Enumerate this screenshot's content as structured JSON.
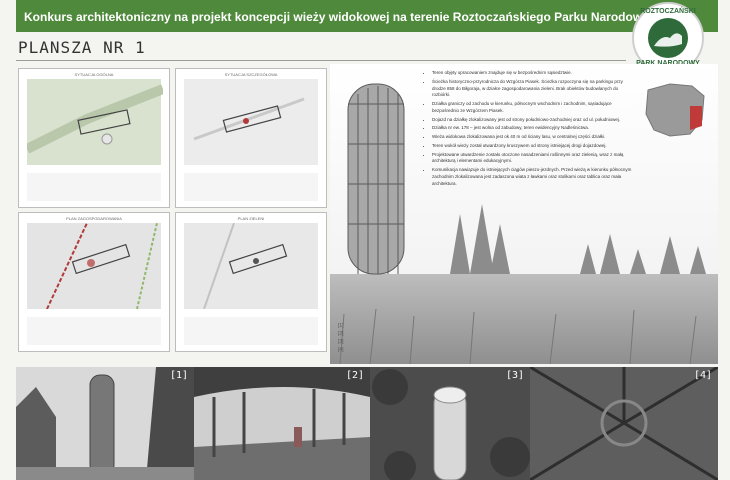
{
  "header": {
    "title": "Konkurs architektoniczny na projekt koncepcji wieży widokowej na terenie Roztoczańskiego Parku Narodowego"
  },
  "logo": {
    "top_text": "ROZTOCZAŃSKI",
    "bottom_text": "PARK NARODOWY"
  },
  "subtitle": "PLANSZA NR 1",
  "description_items": [
    "Teren objęty opracowaniem znajduje się w bezpośrednim sąsiedztwie.",
    "Ścieżka historyczno-przyrodnicza do Wzgórza Piasek. Ścieżka rozpoczyna się na parkingu przy drodze 858 do Biłgoraja, w działce zagospodarowania zieleni. Brak obiektów budowlanych do rozbiórki.",
    "Działka graniczy od zachodu w kierunku, północnym wschodnim i zachodnim, sąsiadujące bezpośrednio ze Wzgórzem Piasek.",
    "Dojazd na działkę zlokalizowany jest od strony południowo-zachodniej oraz od ul. południowej.",
    "Działka nr ew. 178 – jest wolna od zabudowy, teren ewidencyjny Nadleśnictwa.",
    "Wieża widokowa zlokalizowana jest ok 40 m od ściany lasu, w centralnej części działki.",
    "Teren wokół wieży został utwardzony kruszywem od strony istniejącej drogi dojazdowej.",
    "Projektowane utwardzenie zostało otoczone nasadzeniami roślinnymi oraz zielenią, wraz z małą architekturą i elementami edukacyjnymi.",
    "Komunikacja nawiązuje do istniejących ciągów pieszo-jezdnych. Przed wieżą w kierunku północnym zachodnim zlokalizowana jest zadaszona wiata z ławkami oraz stolikami oraz tablica oraz mała architektura."
  ],
  "plans": [
    {
      "label": "SYTUACJA OGÓLNA"
    },
    {
      "label": "SYTUACJA SZCZEGÓŁOWA"
    },
    {
      "label": "PLAN ZAGOSPODAROWANIA"
    },
    {
      "label": "PLAN ZIELENI"
    }
  ],
  "notes": [
    "[1]",
    "[2]",
    "[3]",
    "[4]"
  ],
  "photos": [
    {
      "num": "[1]"
    },
    {
      "num": "[2]"
    },
    {
      "num": "[3]"
    },
    {
      "num": "[4]"
    }
  ],
  "colors": {
    "header": "#4f8a3c",
    "logo_green": "#2f6b3a",
    "map_red": "#b23a3a"
  }
}
